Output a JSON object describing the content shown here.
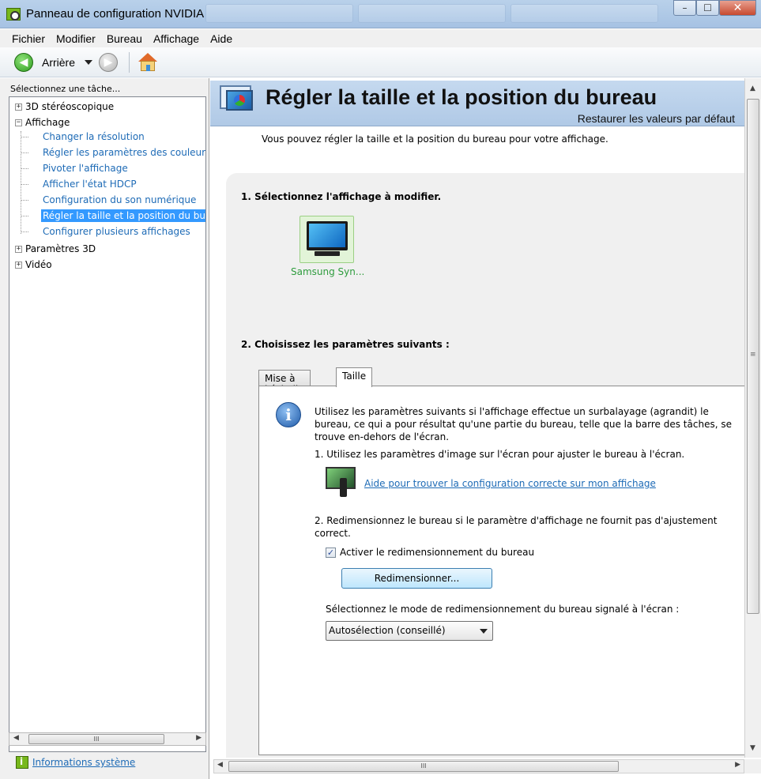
{
  "window": {
    "title": "Panneau de configuration NVIDIA",
    "minimize": "–",
    "maximize": "☐",
    "close": "✕"
  },
  "menu": [
    "Fichier",
    "Modifier",
    "Bureau",
    "Affichage",
    "Aide"
  ],
  "toolbar": {
    "back_label": "Arrière"
  },
  "sidebar": {
    "task_label": "Sélectionnez une tâche...",
    "groups": [
      {
        "label": "3D stéréoscopique",
        "expander": "+"
      },
      {
        "label": "Affichage",
        "expander": "−",
        "children": [
          "Changer la résolution",
          "Régler les paramètres des couleurs du bureau",
          "Pivoter l'affichage",
          "Afficher l'état HDCP",
          "Configuration du son numérique",
          "Régler la taille et la position du bureau",
          "Configurer plusieurs affichages"
        ]
      },
      {
        "label": "Paramètres 3D",
        "expander": "+"
      },
      {
        "label": "Vidéo",
        "expander": "+"
      }
    ],
    "selected_index": 5,
    "system_info": "Informations système"
  },
  "main": {
    "title": "Régler la taille et la position du bureau",
    "restore_link": "Restaurer les valeurs par défaut",
    "intro": "Vous pouvez régler la taille et la position du bureau pour votre affichage.",
    "step1": "1. Sélectionnez l'affichage à modifier.",
    "display_name": "Samsung Syn...",
    "step2": "2. Choisissez les paramètres suivants :",
    "tabs": [
      "Mise à l'échelle",
      "Taille"
    ],
    "active_tab": "Taille",
    "info_text": "Utilisez les paramètres suivants si l'affichage effectue un surbalayage (agrandit) le bureau, ce qui a pour résultat qu'une partie du bureau, telle que la barre des tâches, se trouve en-dehors de l'écran.",
    "item1": "1. Utilisez les paramètres d'image sur l'écran pour ajuster le bureau à l'écran.",
    "help_link": "Aide pour trouver la configuration correcte sur mon affichage",
    "item2": "2. Redimensionnez le bureau si le paramètre d'affichage ne fournit pas d'ajustement correct.",
    "checkbox_label": "Activer le redimensionnement du bureau",
    "checkbox_checked": true,
    "resize_button": "Redimensionner...",
    "mode_label": "Sélectionnez le mode de redimensionnement du bureau signalé à l'écran :",
    "mode_value": "Autosélection (conseillé)"
  },
  "icons": {
    "check": "✓",
    "info": "i",
    "scroll_left": "◀",
    "scroll_right": "▶",
    "scroll_up": "▲",
    "scroll_down": "▼",
    "grip_h": "III",
    "grip_v": "≡"
  }
}
